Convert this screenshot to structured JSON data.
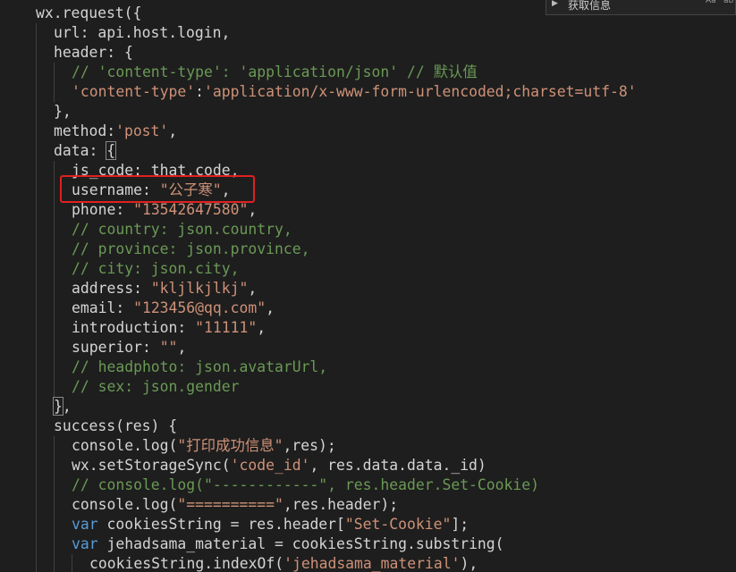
{
  "find_popup": {
    "text": "获取信息",
    "toggle_case_label": "Aa",
    "toggle_word_label": "ab"
  },
  "code_lines": [
    {
      "indent": 0,
      "tokens": [
        {
          "t": "wx.request({",
          "c": "p"
        }
      ]
    },
    {
      "indent": 1,
      "tokens": [
        {
          "t": "url: api.host.login,",
          "c": "p"
        }
      ]
    },
    {
      "indent": 1,
      "tokens": [
        {
          "t": "header: {",
          "c": "p"
        }
      ]
    },
    {
      "indent": 2,
      "tokens": [
        {
          "t": "// 'content-type': 'application/json' // 默认值",
          "c": "c"
        }
      ]
    },
    {
      "indent": 2,
      "tokens": [
        {
          "t": "'content-type'",
          "c": "s"
        },
        {
          "t": ":",
          "c": "p"
        },
        {
          "t": "'application/x-www-form-urlencoded;charset=utf-8'",
          "c": "s"
        }
      ]
    },
    {
      "indent": 1,
      "tokens": [
        {
          "t": "},",
          "c": "p"
        }
      ]
    },
    {
      "indent": 1,
      "tokens": [
        {
          "t": "method:",
          "c": "p"
        },
        {
          "t": "'post'",
          "c": "s"
        },
        {
          "t": ",",
          "c": "p"
        }
      ]
    },
    {
      "indent": 1,
      "tokens": [
        {
          "t": "data: ",
          "c": "p"
        },
        {
          "t": "{",
          "c": "p",
          "hl": true
        }
      ]
    },
    {
      "indent": 2,
      "tokens": [
        {
          "t": "js_code: that.code,",
          "c": "p"
        }
      ]
    },
    {
      "indent": 2,
      "tokens": [
        {
          "t": "username: ",
          "c": "p"
        },
        {
          "t": "\"公子寒\"",
          "c": "s"
        },
        {
          "t": ",",
          "c": "p"
        }
      ]
    },
    {
      "indent": 2,
      "tokens": [
        {
          "t": "phone: ",
          "c": "p"
        },
        {
          "t": "\"13542647580\"",
          "c": "s"
        },
        {
          "t": ",",
          "c": "p"
        }
      ]
    },
    {
      "indent": 2,
      "tokens": [
        {
          "t": "// country: json.country,",
          "c": "c"
        }
      ]
    },
    {
      "indent": 2,
      "tokens": [
        {
          "t": "// province: json.province,",
          "c": "c"
        }
      ]
    },
    {
      "indent": 2,
      "tokens": [
        {
          "t": "// city: json.city,",
          "c": "c"
        }
      ]
    },
    {
      "indent": 2,
      "tokens": [
        {
          "t": "address: ",
          "c": "p"
        },
        {
          "t": "\"kljlkjlkj\"",
          "c": "s"
        },
        {
          "t": ",",
          "c": "p"
        }
      ]
    },
    {
      "indent": 2,
      "tokens": [
        {
          "t": "email: ",
          "c": "p"
        },
        {
          "t": "\"123456@qq.com\"",
          "c": "s"
        },
        {
          "t": ",",
          "c": "p"
        }
      ]
    },
    {
      "indent": 2,
      "tokens": [
        {
          "t": "introduction: ",
          "c": "p"
        },
        {
          "t": "\"11111\"",
          "c": "s"
        },
        {
          "t": ",",
          "c": "p"
        }
      ]
    },
    {
      "indent": 2,
      "tokens": [
        {
          "t": "superior: ",
          "c": "p"
        },
        {
          "t": "\"\"",
          "c": "s"
        },
        {
          "t": ",",
          "c": "p"
        }
      ]
    },
    {
      "indent": 2,
      "tokens": [
        {
          "t": "// headphoto: json.avatarUrl,",
          "c": "c"
        }
      ]
    },
    {
      "indent": 2,
      "tokens": [
        {
          "t": "// sex: json.gender",
          "c": "c"
        }
      ]
    },
    {
      "indent": 1,
      "tokens": [
        {
          "t": "}",
          "c": "p",
          "hl": true
        },
        {
          "t": ",",
          "c": "p"
        }
      ]
    },
    {
      "indent": 1,
      "tokens": [
        {
          "t": "success(res) {",
          "c": "p"
        }
      ]
    },
    {
      "indent": 2,
      "tokens": [
        {
          "t": "console.log(",
          "c": "p"
        },
        {
          "t": "\"打印成功信息\"",
          "c": "s"
        },
        {
          "t": ",res);",
          "c": "p"
        }
      ]
    },
    {
      "indent": 2,
      "tokens": [
        {
          "t": "wx.setStorageSync(",
          "c": "p"
        },
        {
          "t": "'code_id'",
          "c": "s"
        },
        {
          "t": ", res.data.data._id)",
          "c": "p"
        }
      ]
    },
    {
      "indent": 2,
      "tokens": [
        {
          "t": "// console.log(\"------------\", res.header.Set-Cookie)",
          "c": "c"
        }
      ]
    },
    {
      "indent": 2,
      "tokens": [
        {
          "t": "console.log(",
          "c": "p"
        },
        {
          "t": "\"==========\"",
          "c": "s"
        },
        {
          "t": ",res.header);",
          "c": "p"
        }
      ]
    },
    {
      "indent": 2,
      "tokens": [
        {
          "t": "var",
          "c": "k"
        },
        {
          "t": " cookiesString = res.header[",
          "c": "p"
        },
        {
          "t": "\"Set-Cookie\"",
          "c": "s"
        },
        {
          "t": "];",
          "c": "p"
        }
      ]
    },
    {
      "indent": 2,
      "tokens": [
        {
          "t": "var",
          "c": "k"
        },
        {
          "t": " jehadsama_material = cookiesString.substring(",
          "c": "p"
        }
      ]
    },
    {
      "indent": 3,
      "tokens": [
        {
          "t": "cookiesString.indexOf(",
          "c": "p"
        },
        {
          "t": "'jehadsama_material'",
          "c": "s"
        },
        {
          "t": "),",
          "c": "p"
        }
      ]
    }
  ]
}
